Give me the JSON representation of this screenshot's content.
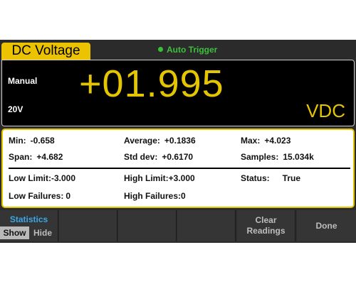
{
  "header": {
    "mode_tab": "DC Voltage",
    "trigger_label": "Auto Trigger"
  },
  "reading": {
    "range_mode": "Manual",
    "range": "20V",
    "value": "+01.995",
    "unit": "VDC"
  },
  "stats": {
    "min": {
      "label": "Min:",
      "value": "-0.658"
    },
    "average": {
      "label": "Average:",
      "value": "+0.1836"
    },
    "max": {
      "label": "Max:",
      "value": "+4.023"
    },
    "span": {
      "label": "Span:",
      "value": "+4.682"
    },
    "std_dev": {
      "label": "Std dev:",
      "value": "+0.6170"
    },
    "samples": {
      "label": "Samples:",
      "value": "15.034k"
    },
    "low_limit": {
      "label": "Low Limit:",
      "value": "-3.000"
    },
    "high_limit": {
      "label": "High Limit:",
      "value": "+3.000"
    },
    "status": {
      "label": "Status:",
      "value": "True"
    },
    "low_failures": {
      "label": "Low Failures:",
      "value": "0"
    },
    "high_failures": {
      "label": "High Failures:",
      "value": "0"
    }
  },
  "softkeys": {
    "statistics": {
      "title": "Statistics",
      "show": "Show",
      "hide": "Hide"
    },
    "clear_line1": "Clear",
    "clear_line2": "Readings",
    "done": "Done"
  },
  "colors": {
    "accent_yellow": "#e5c400",
    "trigger_green": "#36c236",
    "softkey_title_blue": "#3aa7e8"
  }
}
